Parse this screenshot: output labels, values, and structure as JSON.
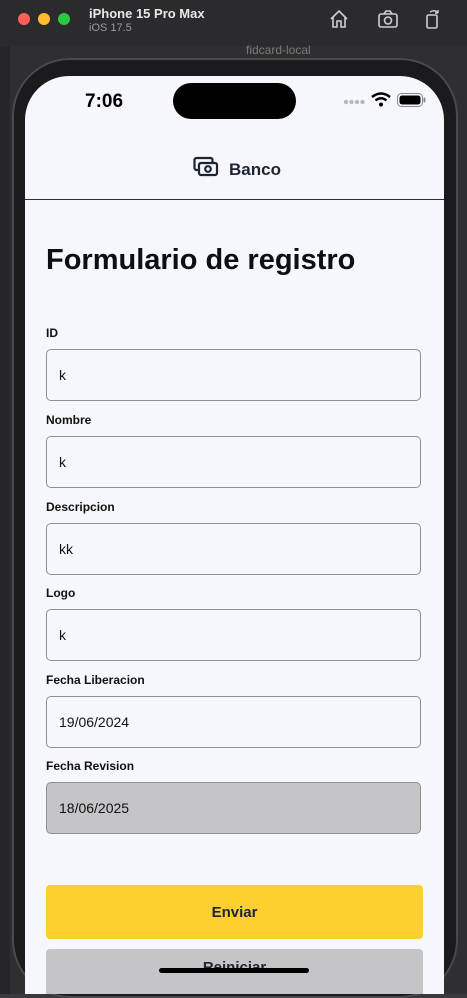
{
  "simulator": {
    "device_name": "iPhone 15 Pro Max",
    "os_version": "iOS 17.5",
    "scheme": "fidcard-local"
  },
  "status_bar": {
    "time": "7:06"
  },
  "nav": {
    "title": "Banco",
    "icon": "banknote-icon"
  },
  "form": {
    "title": "Formulario de registro",
    "fields": [
      {
        "label": "ID",
        "value": "k"
      },
      {
        "label": "Nombre",
        "value": "k"
      },
      {
        "label": "Descripcion",
        "value": "kk"
      },
      {
        "label": "Logo",
        "value": "k"
      },
      {
        "label": "Fecha Liberacion",
        "value": "19/06/2024"
      },
      {
        "label": "Fecha Revision",
        "value": "18/06/2025"
      }
    ],
    "submit_label": "Enviar",
    "reset_label": "Reiniciar"
  },
  "colors": {
    "accent": "#fed02f",
    "disabled_field": "#c5c5c7",
    "background": "#f6f7fd"
  }
}
